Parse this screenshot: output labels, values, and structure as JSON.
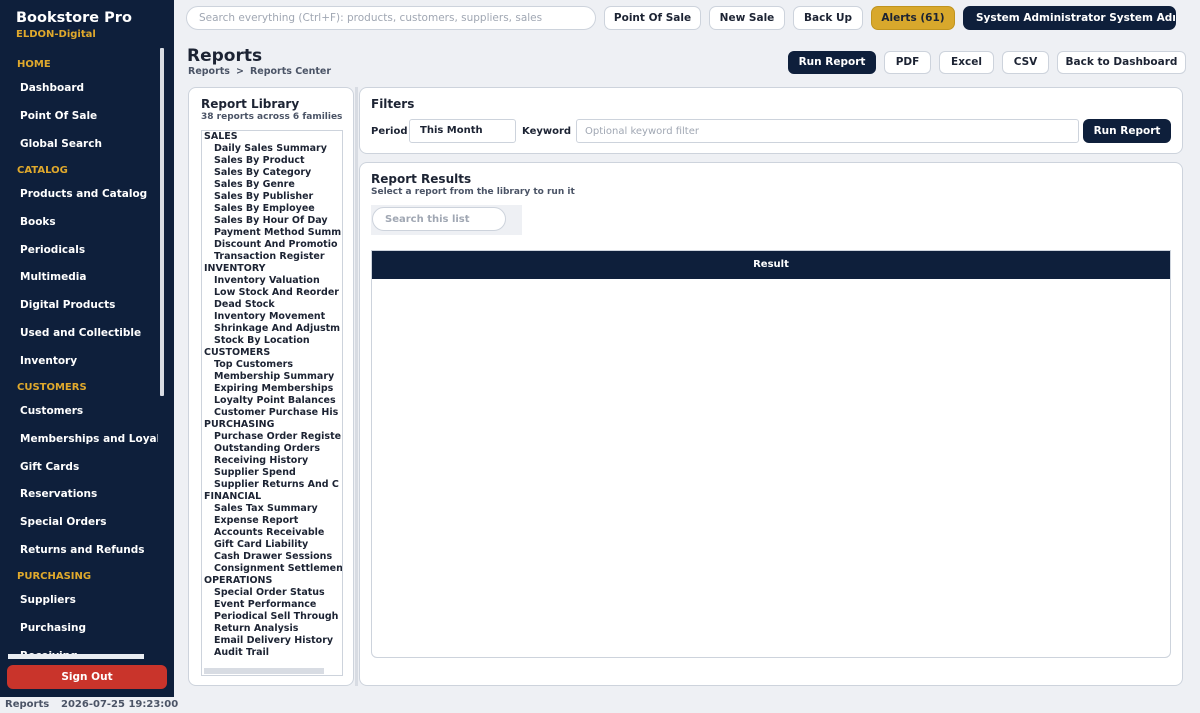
{
  "app": {
    "title": "Bookstore Pro",
    "subtitle": "ELDON-Digital"
  },
  "sidebar": {
    "sections": [
      {
        "label": "HOME",
        "items": [
          "Dashboard",
          "Point Of Sale",
          "Global Search"
        ]
      },
      {
        "label": "CATALOG",
        "items": [
          "Products and Catalog",
          "Books",
          "Periodicals",
          "Multimedia",
          "Digital Products",
          "Used and Collectible",
          "Inventory"
        ]
      },
      {
        "label": "CUSTOMERS",
        "items": [
          "Customers",
          "Memberships and Loyalty",
          "Gift Cards",
          "Reservations",
          "Special Orders",
          "Returns and Refunds"
        ]
      },
      {
        "label": "PURCHASING",
        "items": [
          "Suppliers",
          "Purchasing",
          "Receiving"
        ]
      }
    ],
    "sign_out": "Sign Out"
  },
  "topbar": {
    "search_placeholder": "Search everything (Ctrl+F): products, customers, suppliers, sales",
    "point_of_sale": "Point Of Sale",
    "new_sale": "New Sale",
    "back_up": "Back Up",
    "alerts": "Alerts (61)",
    "user": "System Administrator   System Admi"
  },
  "page": {
    "title": "Reports",
    "breadcrumb": [
      "Reports",
      ">",
      "Reports Center"
    ],
    "actions": {
      "run_report": "Run Report",
      "pdf": "PDF",
      "excel": "Excel",
      "csv": "CSV",
      "back": "Back to Dashboard"
    }
  },
  "library": {
    "title": "Report Library",
    "subtitle": "38 reports across 6 families",
    "families": [
      {
        "name": "SALES",
        "reports": [
          "Daily Sales Summary",
          "Sales By Product",
          "Sales By Category",
          "Sales By Genre",
          "Sales By Publisher",
          "Sales By Employee",
          "Sales By Hour Of Day",
          "Payment Method Summ",
          "Discount And Promotio",
          "Transaction Register"
        ]
      },
      {
        "name": "INVENTORY",
        "reports": [
          "Inventory Valuation",
          "Low Stock And Reorder",
          "Dead Stock",
          "Inventory Movement",
          "Shrinkage And Adjustm",
          "Stock By Location"
        ]
      },
      {
        "name": "CUSTOMERS",
        "reports": [
          "Top Customers",
          "Membership Summary",
          "Expiring Memberships",
          "Loyalty Point Balances",
          "Customer Purchase His"
        ]
      },
      {
        "name": "PURCHASING",
        "reports": [
          "Purchase Order Registe",
          "Outstanding Orders",
          "Receiving History",
          "Supplier Spend",
          "Supplier Returns And C"
        ]
      },
      {
        "name": "FINANCIAL",
        "reports": [
          "Sales Tax Summary",
          "Expense Report",
          "Accounts Receivable",
          "Gift Card Liability",
          "Cash Drawer Sessions",
          "Consignment Settlemen"
        ]
      },
      {
        "name": "OPERATIONS",
        "reports": [
          "Special Order Status",
          "Event Performance",
          "Periodical Sell Through",
          "Return Analysis",
          "Email Delivery History",
          "Audit Trail"
        ]
      }
    ]
  },
  "filters": {
    "title": "Filters",
    "period_label": "Period",
    "period_value": "This Month",
    "keyword_label": "Keyword",
    "keyword_placeholder": "Optional keyword filter",
    "run": "Run Report"
  },
  "results": {
    "title": "Report Results",
    "subtitle": "Select a report from the library to run it",
    "search_placeholder": "Search this list",
    "column": "Result"
  },
  "status": {
    "page": "Reports",
    "time": "2026-07-25 19:23:00"
  },
  "colors": {
    "navy": "#0e1f3b",
    "gold": "#e0a92c",
    "danger": "#c9342b",
    "alerts": "#d8a82c"
  }
}
